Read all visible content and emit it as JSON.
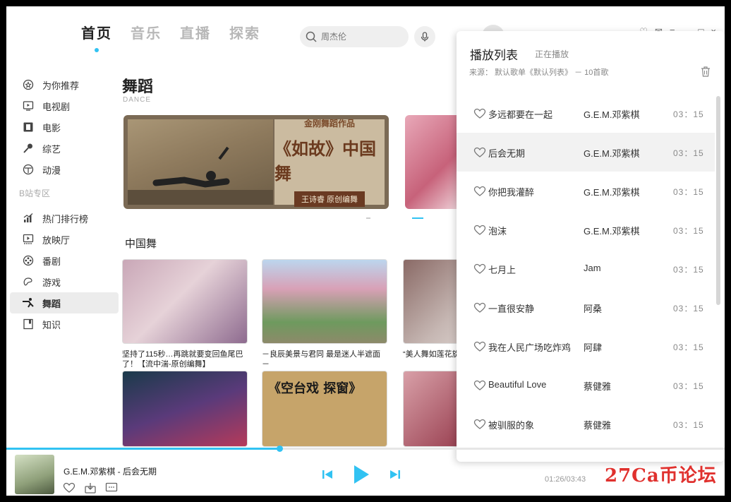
{
  "topnav": {
    "tabs": [
      "首页",
      "音乐",
      "直播",
      "探索"
    ]
  },
  "search": {
    "placeholder": "周杰伦"
  },
  "sidebar": {
    "items": [
      {
        "label": "为你推荐",
        "icon": "recommend-icon"
      },
      {
        "label": "电视剧",
        "icon": "tv-icon"
      },
      {
        "label": "电影",
        "icon": "film-icon"
      },
      {
        "label": "综艺",
        "icon": "microphone-icon"
      },
      {
        "label": "动漫",
        "icon": "anime-icon"
      }
    ],
    "section": "B站专区",
    "section_items": [
      {
        "label": "热门排行榜",
        "icon": "chart-icon"
      },
      {
        "label": "放映厅",
        "icon": "theater-icon"
      },
      {
        "label": "番剧",
        "icon": "reel-icon"
      },
      {
        "label": "游戏",
        "icon": "gamepad-icon"
      },
      {
        "label": "舞蹈",
        "icon": "dance-icon",
        "active": true
      },
      {
        "label": "知识",
        "icon": "book-icon"
      }
    ]
  },
  "main": {
    "category_title": "舞蹈",
    "category_sub": "DANCE",
    "banner": {
      "line1": "金刚舞蹈作品",
      "line2": "《如故》中国舞",
      "line3": "王诗睿 原创编舞"
    },
    "section_title": "中国舞",
    "cards": [
      {
        "caption": "坚持了115秒…再跳就要变回鱼尾巴了！【流中湍-原创编舞】"
      },
      {
        "caption": "－良辰美景与君同 最是迷人半遮面－"
      },
      {
        "caption": "“美人舞如莲花旋”第一次被国家"
      }
    ],
    "cards2": [
      {
        "caption": ""
      },
      {
        "caption": "《空台戏 探窗》"
      },
      {
        "caption": ""
      }
    ]
  },
  "player": {
    "now_playing": "G.E.M.邓紫棋 - 后会无期",
    "time": "01:26/03:43",
    "progress": 0.38
  },
  "playlist": {
    "title": "播放列表",
    "subtitle": "正在播放",
    "source": "来源：  默认歌单《默认列表》 － 10首歌",
    "songs": [
      {
        "song": "多远都要在一起",
        "artist": "G.E.M.邓紫棋",
        "duration": "03：15"
      },
      {
        "song": "后会无期",
        "artist": "G.E.M.邓紫棋",
        "duration": "03：15",
        "current": true
      },
      {
        "song": "你把我灌醉",
        "artist": "G.E.M.邓紫棋",
        "duration": "03：15"
      },
      {
        "song": "泡沫",
        "artist": "G.E.M.邓紫棋",
        "duration": "03：15"
      },
      {
        "song": "七月上",
        "artist": "Jam",
        "duration": "03：15"
      },
      {
        "song": "一直很安静",
        "artist": "阿桑",
        "duration": "03：15"
      },
      {
        "song": "我在人民广场吃炸鸡",
        "artist": "阿肆",
        "duration": "03：15"
      },
      {
        "song": "Beautiful Love",
        "artist": "蔡健雅",
        "duration": "03：15"
      },
      {
        "song": "被驯服的象",
        "artist": "蔡健雅",
        "duration": "03：15"
      }
    ]
  },
  "watermark": "27Ca币论坛",
  "colors": {
    "accent": "#31c2f2"
  }
}
